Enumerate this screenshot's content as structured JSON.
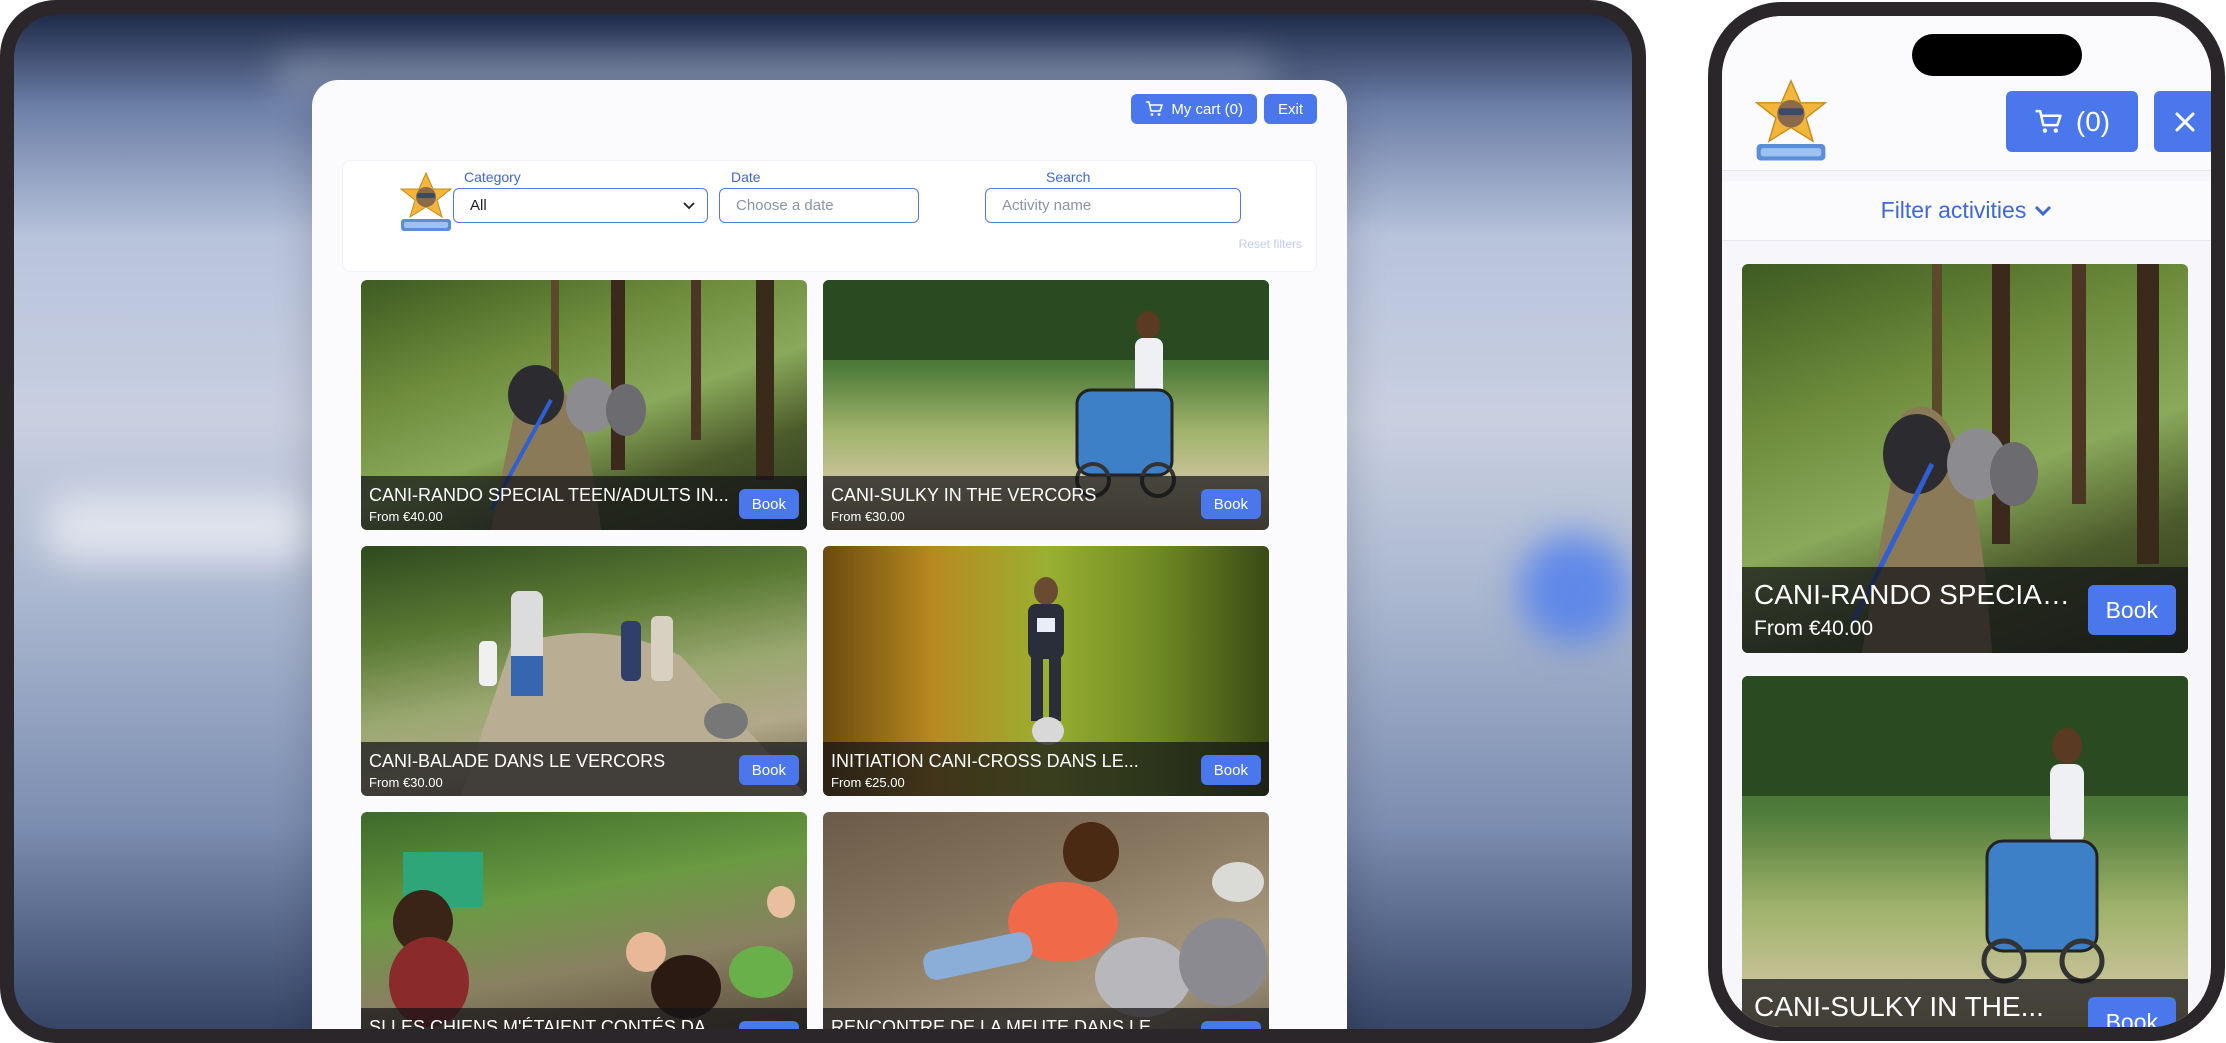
{
  "tablet": {
    "header": {
      "cart_label": "My cart (0)",
      "exit_label": "Exit"
    },
    "filters": {
      "category_label": "Category",
      "category_value": "All",
      "date_label": "Date",
      "date_placeholder": "Choose a date",
      "search_label": "Search",
      "search_placeholder": "Activity name",
      "reset_label": "Reset filters"
    },
    "activities": [
      {
        "title": "CANI-RANDO SPECIAL TEEN/ADULTS IN...",
        "price": "From €40.00",
        "book_label": "Book"
      },
      {
        "title": "CANI-SULKY IN THE VERCORS",
        "price": "From €30.00",
        "book_label": "Book"
      },
      {
        "title": "CANI-BALADE DANS LE VERCORS",
        "price": "From €30.00",
        "book_label": "Book"
      },
      {
        "title": "INITIATION CANI-CROSS DANS LE...",
        "price": "From €25.00",
        "book_label": "Book"
      },
      {
        "title": "SI LES CHIENS M'ÉTAIENT CONTÉS DAN...",
        "price": "",
        "book_label": "Book"
      },
      {
        "title": "RENCONTRE DE LA MEUTE DANS LE...",
        "price": "",
        "book_label": "Book"
      }
    ]
  },
  "phone": {
    "cart_label": "(0)",
    "filter_label": "Filter activities",
    "activities": [
      {
        "title": "CANI-RANDO SPECIAL...",
        "price": "From €40.00",
        "book_label": "Book"
      },
      {
        "title": "CANI-SULKY IN THE...",
        "price": "",
        "book_label": "Book"
      }
    ]
  },
  "colors": {
    "accent": "#4a78ec",
    "link": "#3e67d8",
    "frame": "#2b2629"
  },
  "icons": [
    "cart-icon",
    "chevron-down-icon",
    "close-icon",
    "logo-icon"
  ]
}
